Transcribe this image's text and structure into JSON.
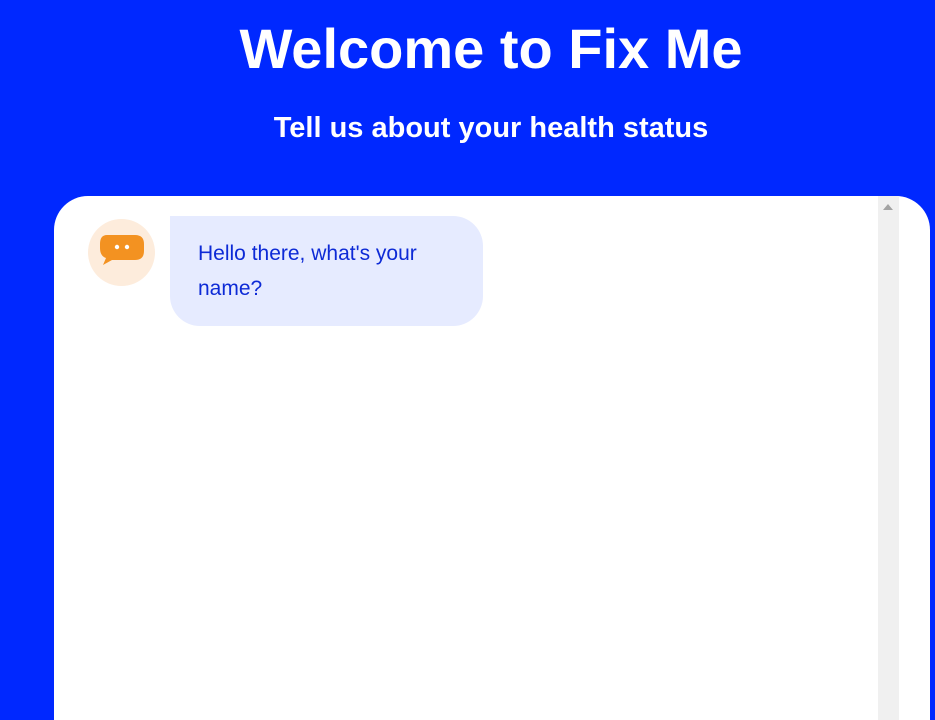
{
  "header": {
    "title": "Welcome to Fix Me",
    "subtitle": "Tell us about your health status"
  },
  "chat": {
    "messages": [
      {
        "sender": "bot",
        "avatar_icon": "chat-bubble-icon",
        "text": "Hello there, what's your name?"
      }
    ]
  },
  "colors": {
    "background": "#0028ff",
    "panel": "#ffffff",
    "bubble": "#e6ebff",
    "bubble_text": "#0d2ad6",
    "avatar_bg": "#fdecdc",
    "avatar_icon": "#f39221",
    "scrollbar": "#f0f0f0"
  }
}
